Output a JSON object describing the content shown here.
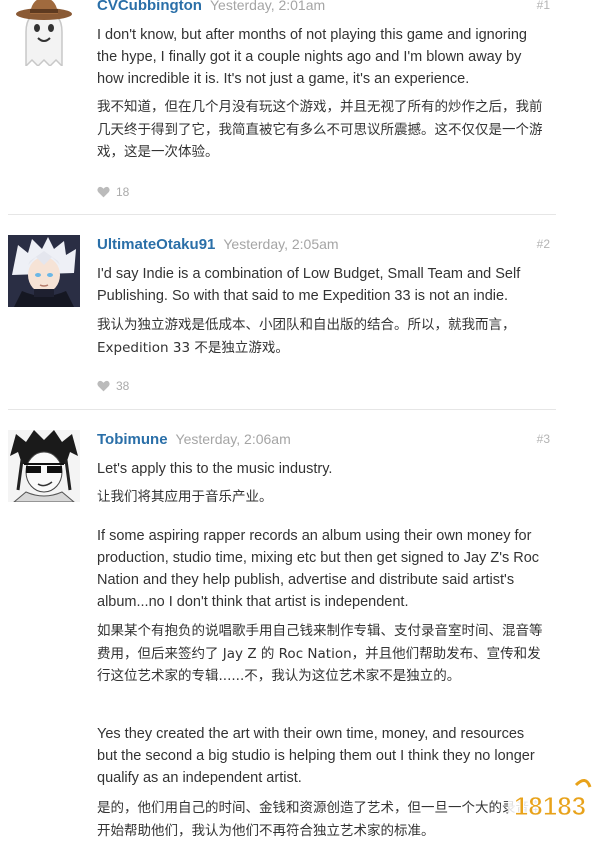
{
  "posts": [
    {
      "username": "CVCubbington",
      "timestamp": "Yesterday, 2:01am",
      "post_number": "#1",
      "paragraphs": [
        "I don't know, but after months of not playing this game and ignoring the hype, I finally got it a couple nights ago and I'm blown away by how incredible it is. It's not just a game, it's an experience.",
        "我不知道，但在几个月没有玩这个游戏，并且无视了所有的炒作之后，我前几天终于得到了它，我简直被它有多么不可思议所震撼。这不仅仅是一个游戏，这是一次体验。"
      ],
      "likes": "18",
      "avatar_icon": "cowboy-ghost-icon"
    },
    {
      "username": "UltimateOtaku91",
      "timestamp": "Yesterday, 2:05am",
      "post_number": "#2",
      "paragraphs": [
        "I'd say Indie is a combination of Low Budget, Small Team and Self Publishing. So with that said to me Expedition 33 is not an indie.",
        "我认为独立游戏是低成本、小团队和自出版的结合。所以，就我而言，Expedition 33 不是独立游戏。"
      ],
      "likes": "38",
      "avatar_icon": "anime-character-icon"
    },
    {
      "username": "Tobimune",
      "timestamp": "Yesterday, 2:06am",
      "post_number": "#3",
      "paragraphs": [
        "Let's apply this to the music industry.",
        "让我们将其应用于音乐产业。",
        "If some aspiring rapper records an album using their own money for production, studio time, mixing etc but then get signed to Jay Z's Roc Nation and they help publish, advertise and distribute said artist's album...no I don't think that artist is independent.",
        "如果某个有抱负的说唱歌手用自己钱来制作专辑、支付录音室时间、混音等费用，但后来签约了 Jay Z 的 Roc Nation，并且他们帮助发布、宣传和发行这位艺术家的专辑......不，我认为这位艺术家不是独立的。",
        "Yes they created the art with their own time, money, and resources but the second a big studio is helping them out I think they no longer qualify as an independent artist.",
        "是的，他们用自己的时间、金钱和资源创造了艺术，但一旦一个大的录音室开始帮助他们，我认为他们不再符合独立艺术家的标准。"
      ],
      "avatar_icon": "manga-character-icon"
    }
  ],
  "watermark": "18183",
  "colors": {
    "username": "#2a6fa8",
    "timestamp": "#a5a5a5",
    "divider": "#e6e6e6",
    "watermark": "#e8a21a"
  }
}
